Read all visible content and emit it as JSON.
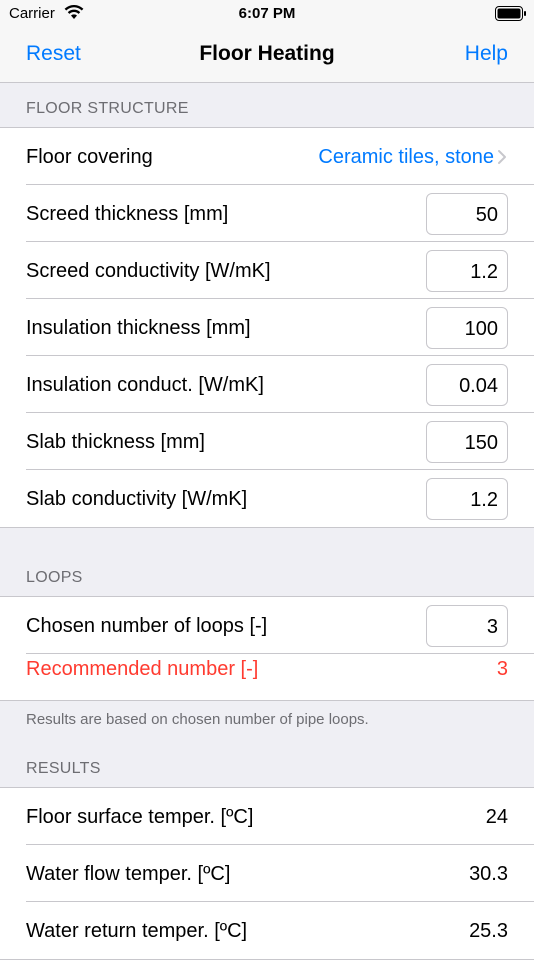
{
  "status": {
    "carrier": "Carrier",
    "time": "6:07 PM"
  },
  "nav": {
    "left": "Reset",
    "title": "Floor Heating",
    "right": "Help"
  },
  "floor_structure": {
    "header": "FLOOR STRUCTURE",
    "covering_label": "Floor covering",
    "covering_value": "Ceramic tiles, stone",
    "rows": [
      {
        "label": "Screed thickness [mm]",
        "value": "50"
      },
      {
        "label": "Screed conductivity [W/mK]",
        "value": "1.2"
      },
      {
        "label": "Insulation thickness [mm]",
        "value": "100"
      },
      {
        "label": "Insulation conduct. [W/mK]",
        "value": "0.04"
      },
      {
        "label": "Slab thickness [mm]",
        "value": "150"
      },
      {
        "label": "Slab conductivity [W/mK]",
        "value": "1.2"
      }
    ]
  },
  "loops": {
    "header": "LOOPS",
    "chosen_label": "Chosen number of loops [-]",
    "chosen_value": "3",
    "recommended_label": "Recommended number [-]",
    "recommended_value": "3",
    "footer": "Results are based on chosen number of pipe loops."
  },
  "results": {
    "header": "RESULTS",
    "rows": [
      {
        "label": "Floor surface temper. [ºC]",
        "value": "24"
      },
      {
        "label": "Water flow temper. [ºC]",
        "value": "30.3"
      },
      {
        "label": "Water return temper. [ºC]",
        "value": "25.3"
      }
    ]
  },
  "colors": {
    "accent": "#007aff",
    "warning": "#ff3b30",
    "background": "#efeff4"
  }
}
